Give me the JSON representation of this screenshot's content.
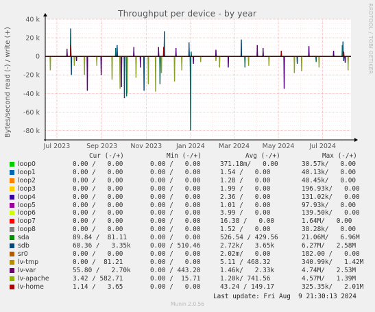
{
  "chart_data": {
    "type": "line",
    "title": "Throughput per device - by year",
    "ylabel": "Bytes/second read (-) / write (+)",
    "ylim": [
      -90000,
      40000
    ],
    "y_ticks": [
      {
        "value": 40000,
        "label": "40 k"
      },
      {
        "value": 20000,
        "label": "20 k"
      },
      {
        "value": 0,
        "label": "0"
      },
      {
        "value": -20000,
        "label": "-20 k"
      },
      {
        "value": -40000,
        "label": "-40 k"
      },
      {
        "value": -60000,
        "label": "-60 k"
      },
      {
        "value": -80000,
        "label": "-80 k"
      }
    ],
    "x_range": [
      "2023-06-15",
      "2024-08-09"
    ],
    "x_ticks": [
      {
        "date": "2023-07-01",
        "label": "Jul 2023"
      },
      {
        "date": "2023-09-01",
        "label": "Sep 2023"
      },
      {
        "date": "2023-11-01",
        "label": "Nov 2023"
      },
      {
        "date": "2024-01-01",
        "label": "Jan 2024"
      },
      {
        "date": "2024-03-01",
        "label": "Mar 2024"
      },
      {
        "date": "2024-05-01",
        "label": "May 2024"
      },
      {
        "date": "2024-07-01",
        "label": "Jul 2024"
      }
    ],
    "grid": true,
    "series": [
      {
        "name": "sda",
        "color": "#00487d",
        "spikes": [
          {
            "date": "2023-07-20",
            "value": 30000
          },
          {
            "date": "2023-07-21",
            "value": -20000
          },
          {
            "date": "2023-09-22",
            "value": 12000
          },
          {
            "date": "2023-10-02",
            "value": -45000
          },
          {
            "date": "2023-10-29",
            "value": -37000
          },
          {
            "date": "2023-11-26",
            "value": 27000
          },
          {
            "date": "2023-12-30",
            "value": 15000
          },
          {
            "date": "2024-01-01",
            "value": -32000
          },
          {
            "date": "2024-03-11",
            "value": 18000
          },
          {
            "date": "2024-05-27",
            "value": -8000
          },
          {
            "date": "2024-07-29",
            "value": 16000
          },
          {
            "date": "2024-07-30",
            "value": -5000
          }
        ]
      },
      {
        "name": "sdb",
        "color": "#006e60",
        "spikes": [
          {
            "date": "2023-07-20",
            "value": 25000
          },
          {
            "date": "2023-09-20",
            "value": 9000
          },
          {
            "date": "2023-10-05",
            "value": -43000
          },
          {
            "date": "2023-11-20",
            "value": -30000
          },
          {
            "date": "2024-01-01",
            "value": -80000
          },
          {
            "date": "2024-01-02",
            "value": 5000
          },
          {
            "date": "2024-03-16",
            "value": -12000
          },
          {
            "date": "2024-06-22",
            "value": -6000
          },
          {
            "date": "2024-07-28",
            "value": 12000
          }
        ]
      },
      {
        "name": "lv-var",
        "color": "#56007a",
        "spikes": [
          {
            "date": "2023-07-15",
            "value": 8000
          },
          {
            "date": "2023-07-28",
            "value": -5000
          },
          {
            "date": "2023-08-12",
            "value": -37000
          },
          {
            "date": "2023-08-31",
            "value": -20000
          },
          {
            "date": "2023-09-28",
            "value": -33000
          },
          {
            "date": "2023-10-15",
            "value": 10000
          },
          {
            "date": "2023-10-24",
            "value": -12000
          },
          {
            "date": "2023-11-18",
            "value": 10000
          },
          {
            "date": "2023-12-12",
            "value": 9000
          },
          {
            "date": "2024-01-05",
            "value": -8000
          },
          {
            "date": "2024-02-05",
            "value": 7000
          },
          {
            "date": "2024-02-22",
            "value": -12000
          },
          {
            "date": "2024-04-02",
            "value": 12000
          },
          {
            "date": "2024-04-10",
            "value": 9000
          },
          {
            "date": "2024-05-09",
            "value": -35000
          },
          {
            "date": "2024-06-12",
            "value": 11000
          },
          {
            "date": "2024-07-16",
            "value": 6000
          },
          {
            "date": "2024-08-01",
            "value": -7000
          }
        ]
      },
      {
        "name": "lv-apache",
        "color": "#88a021",
        "spikes": [
          {
            "date": "2023-06-22",
            "value": -15000
          },
          {
            "date": "2023-07-25",
            "value": -10000
          },
          {
            "date": "2023-08-08",
            "value": -20000
          },
          {
            "date": "2023-08-25",
            "value": -10000
          },
          {
            "date": "2023-09-15",
            "value": -25000
          },
          {
            "date": "2023-09-26",
            "value": -35000
          },
          {
            "date": "2023-10-06",
            "value": -40000
          },
          {
            "date": "2023-10-18",
            "value": -23000
          },
          {
            "date": "2023-11-04",
            "value": -30000
          },
          {
            "date": "2023-11-14",
            "value": -38000
          },
          {
            "date": "2023-11-22",
            "value": -18000
          },
          {
            "date": "2023-12-10",
            "value": -27000
          },
          {
            "date": "2023-12-20",
            "value": -15000
          },
          {
            "date": "2024-01-15",
            "value": -6000
          },
          {
            "date": "2024-02-05",
            "value": -5000
          },
          {
            "date": "2024-02-10",
            "value": -12000
          },
          {
            "date": "2024-03-21",
            "value": -10000
          },
          {
            "date": "2024-04-18",
            "value": -10000
          },
          {
            "date": "2024-05-23",
            "value": -18000
          },
          {
            "date": "2024-06-02",
            "value": -16000
          },
          {
            "date": "2024-06-26",
            "value": -12000
          },
          {
            "date": "2024-08-05",
            "value": -15000
          }
        ]
      },
      {
        "name": "lv-home",
        "color": "#a00000",
        "spikes": [
          {
            "date": "2023-07-20",
            "value": 12000
          },
          {
            "date": "2023-11-25",
            "value": 10000
          },
          {
            "date": "2024-05-05",
            "value": 6000
          },
          {
            "date": "2024-07-30",
            "value": 5000
          }
        ]
      }
    ]
  },
  "legend": {
    "header": {
      "cur": "Cur (-/+)",
      "min": "Min (-/+)",
      "avg": "Avg (-/+)",
      "max": "Max (-/+)"
    },
    "rows": [
      {
        "name": "loop0",
        "color": "#00cc00",
        "cur": "0.00 /   0.00",
        "min": "0.00 /   0.00",
        "avg": "371.18m/   0.00",
        "max": "30.57k/   0.00"
      },
      {
        "name": "loop1",
        "color": "#0066b3",
        "cur": "0.00 /   0.00",
        "min": "0.00 /   0.00",
        "avg": "1.54 /   0.00",
        "max": "40.13k/   0.00"
      },
      {
        "name": "loop2",
        "color": "#ff8000",
        "cur": "0.00 /   0.00",
        "min": "0.00 /   0.00",
        "avg": "1.28 /   0.00",
        "max": "40.45k/   0.00"
      },
      {
        "name": "loop3",
        "color": "#ffcc00",
        "cur": "0.00 /   0.00",
        "min": "0.00 /   0.00",
        "avg": "1.99 /   0.00",
        "max": "196.93k/   0.00"
      },
      {
        "name": "loop4",
        "color": "#330099",
        "cur": "0.00 /   0.00",
        "min": "0.00 /   0.00",
        "avg": "2.36 /   0.00",
        "max": "131.02k/   0.00"
      },
      {
        "name": "loop5",
        "color": "#990099",
        "cur": "0.00 /   0.00",
        "min": "0.00 /   0.00",
        "avg": "1.01 /   0.00",
        "max": "97.93k/   0.00"
      },
      {
        "name": "loop6",
        "color": "#ccff00",
        "cur": "0.00 /   0.00",
        "min": "0.00 /   0.00",
        "avg": "3.99 /   0.00",
        "max": "139.50k/   0.00"
      },
      {
        "name": "loop7",
        "color": "#ff0000",
        "cur": "0.00 /   0.00",
        "min": "0.00 /   0.00",
        "avg": "16.38 /   0.00",
        "max": "1.64M/   0.00"
      },
      {
        "name": "loop8",
        "color": "#808080",
        "cur": "0.00 /   0.00",
        "min": "0.00 /   0.00",
        "avg": "1.52 /   0.00",
        "max": "38.28k/   0.00"
      },
      {
        "name": "sda",
        "color": "#008f00",
        "cur": "89.84 /  81.11",
        "min": "0.00 /   0.00",
        "avg": "526.54 / 429.56",
        "max": "21.06M/   6.96M"
      },
      {
        "name": "sdb",
        "color": "#00487d",
        "cur": "60.36 /   3.35k",
        "min": "0.00 / 510.46",
        "avg": "2.72k/   3.65k",
        "max": "6.27M/   2.58M"
      },
      {
        "name": "sr0",
        "color": "#b35a00",
        "cur": "0.00 /   0.00",
        "min": "0.00 /   0.00",
        "avg": "2.02m/   0.00",
        "max": "182.00 /   0.00"
      },
      {
        "name": "lv-tmp",
        "color": "#b38f00",
        "cur": "0.00 /  81.21",
        "min": "0.00 /   0.00",
        "avg": "5.11 / 468.32",
        "max": "340.99k/   1.42M"
      },
      {
        "name": "lv-var",
        "color": "#6b006b",
        "cur": "55.80 /   2.70k",
        "min": "0.00 / 443.20",
        "avg": "1.46k/   2.33k",
        "max": "4.74M/   2.53M"
      },
      {
        "name": "lv-apache",
        "color": "#8fb300",
        "cur": "3.42 / 582.71",
        "min": "0.00 /  15.71",
        "avg": "1.20k/ 741.56",
        "max": "4.57M/   1.39M"
      },
      {
        "name": "lv-home",
        "color": "#b30000",
        "cur": "1.14 /   3.65",
        "min": "0.00 /   0.00",
        "avg": "43.24 / 149.17",
        "max": "325.35k/   2.01M"
      }
    ]
  },
  "footer": {
    "last_update": "Last update: Fri Aug  9 21:30:13 2024",
    "munin": "Munin 2.0.56",
    "rrdtool": "RRDTOOL / TOBI OETIKER"
  }
}
